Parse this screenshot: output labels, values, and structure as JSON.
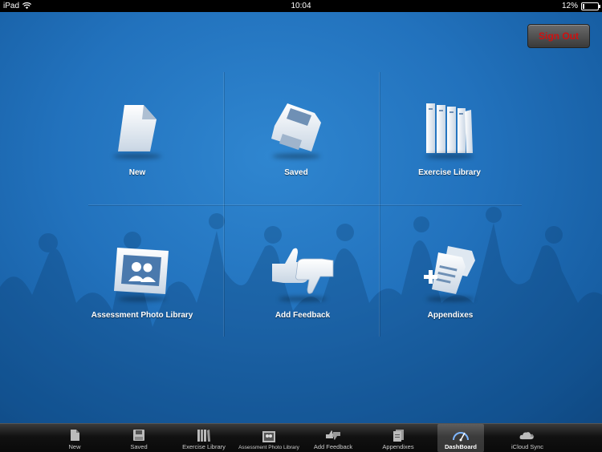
{
  "status_bar": {
    "carrier": "iPad",
    "time": "10:04",
    "battery": "12%"
  },
  "header": {
    "sign_out_label": "Sign Out"
  },
  "tiles": [
    {
      "label": "New",
      "icon": "document-icon"
    },
    {
      "label": "Saved",
      "icon": "floppy-disk-icon"
    },
    {
      "label": "Exercise Library",
      "icon": "books-icon"
    },
    {
      "label": "Assessment Photo Library",
      "icon": "photo-icon"
    },
    {
      "label": "Add Feedback",
      "icon": "thumbs-icon"
    },
    {
      "label": "Appendixes",
      "icon": "appendix-icon"
    }
  ],
  "tab_bar": {
    "items": [
      {
        "label": "New",
        "icon": "document-icon"
      },
      {
        "label": "Saved",
        "icon": "floppy-disk-icon"
      },
      {
        "label": "Exercise Library",
        "icon": "books-icon"
      },
      {
        "label": "Assessment Photo Library",
        "icon": "photo-icon"
      },
      {
        "label": "Add Feedback",
        "icon": "thumbs-icon"
      },
      {
        "label": "Appendixes",
        "icon": "appendix-icon"
      },
      {
        "label": "DashBoard",
        "icon": "dashboard-icon",
        "active": true
      },
      {
        "label": "iCloud Sync",
        "icon": "cloud-sync-icon"
      }
    ]
  },
  "colors": {
    "background": "#2272bd",
    "sign_out_text": "#d01010"
  }
}
